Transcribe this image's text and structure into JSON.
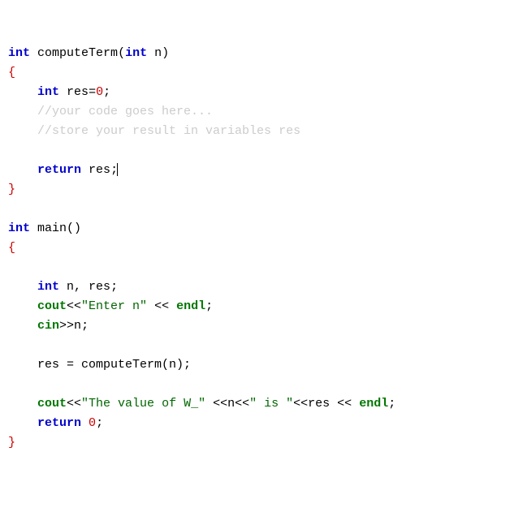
{
  "line1": {
    "kw_int": "int",
    "name": "computeTerm",
    "kw_int2": "int",
    "param": "n",
    "close": ")"
  },
  "line2": {
    "brace": "{"
  },
  "line3": {
    "kw_int": "int",
    "var": "res",
    "eq": "=",
    "num": "0",
    "semi": ";"
  },
  "line4": {
    "comment": "//your code goes here..."
  },
  "line5": {
    "comment": "//store your result in variables res"
  },
  "line6": {
    "kw_return": "return",
    "var": "res",
    "semi": ";"
  },
  "line7": {
    "brace": "}"
  },
  "line8": {
    "kw_int": "int",
    "name": "main",
    "close": "()"
  },
  "line9": {
    "brace": "{"
  },
  "line10": {
    "kw_int": "int",
    "vars": "n, res",
    "semi": ";"
  },
  "line11": {
    "cout": "cout",
    "op1": "<<",
    "str": "\"Enter n\"",
    "op2": " << ",
    "endl": "endl",
    "semi": ";"
  },
  "line12": {
    "cin": "cin",
    "op": ">>",
    "var": "n",
    "semi": ";"
  },
  "line13": {
    "lhs": "res = computeTerm(n)",
    "semi": ";"
  },
  "line14": {
    "cout": "cout",
    "op1": "<<",
    "str1": "\"The value of W_\"",
    "op2": " <<",
    "var1": "n",
    "op3": "<<",
    "str2": "\" is \"",
    "op4": "<<",
    "var2": "res",
    "op5": " << ",
    "endl": "endl",
    "semi": ";"
  },
  "line15": {
    "kw_return": "return",
    "num": "0",
    "semi": ";"
  },
  "line16": {
    "brace": "}"
  }
}
